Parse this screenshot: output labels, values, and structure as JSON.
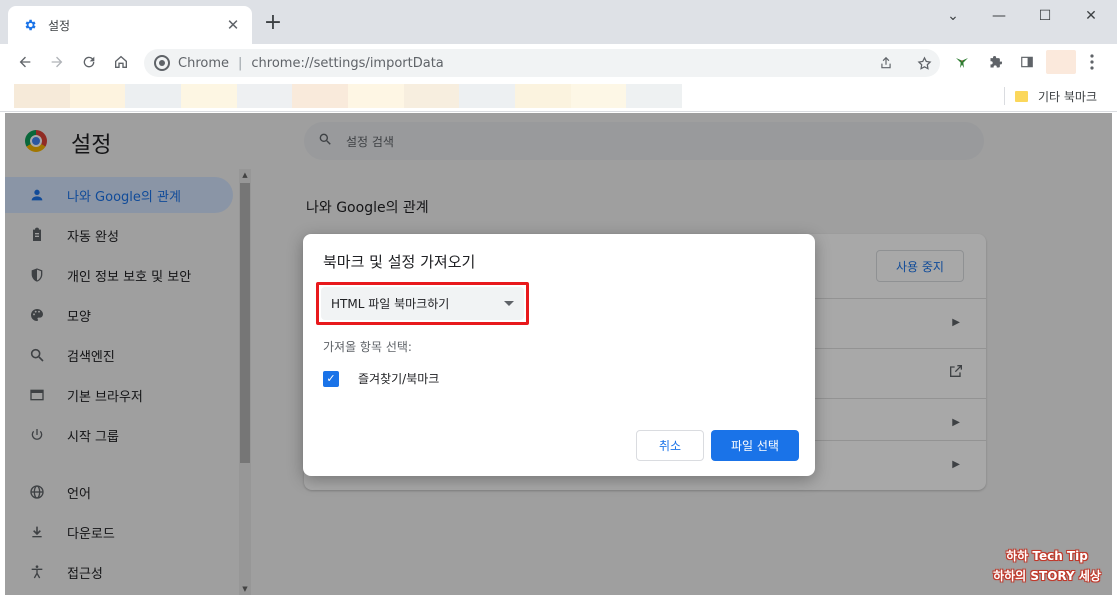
{
  "tab": {
    "title": "설정",
    "close": "✕",
    "new_tab": "+"
  },
  "window": {
    "minimize": "—",
    "maximize": "☐",
    "close": "✕",
    "tabsearch": "⌄"
  },
  "omnibox": {
    "site": "Chrome",
    "separator": "|",
    "url": "chrome://settings/importData"
  },
  "bookmarks": {
    "other_label": "기타 북마크",
    "blur_colors": [
      "#f6ead9",
      "#fdf3df",
      "#eceff1",
      "#fdf6e3",
      "#eef0f2",
      "#f9eadb",
      "#fef6e4",
      "#f7eedf",
      "#edf0f2",
      "#fbf3df",
      "#fdf7e6",
      "#eef1f2"
    ]
  },
  "settings": {
    "title": "설정",
    "search_placeholder": "설정 검색",
    "section_title": "나와 Google의 관계",
    "stop_sync": "사용 중지",
    "sidebar": [
      {
        "label": "나와 Google의 관계",
        "icon": "person-icon",
        "active": true
      },
      {
        "label": "자동 완성",
        "icon": "clipboard-icon"
      },
      {
        "label": "개인 정보 보호 및 보안",
        "icon": "shield-icon"
      },
      {
        "label": "모양",
        "icon": "palette-icon"
      },
      {
        "label": "검색엔진",
        "icon": "search-icon"
      },
      {
        "label": "기본 브라우저",
        "icon": "browser-icon"
      },
      {
        "label": "시작 그룹",
        "icon": "power-icon"
      },
      {
        "label": "언어",
        "icon": "globe-icon"
      },
      {
        "label": "다운로드",
        "icon": "download-icon"
      },
      {
        "label": "접근성",
        "icon": "accessibility-icon"
      }
    ]
  },
  "dialog": {
    "title": "북마크 및 설정 가져오기",
    "select_value": "HTML 파일 북마크하기",
    "items_label": "가져올 항목 선택:",
    "checkbox_label": "즐겨찾기/북마크",
    "checkbox_checked": true,
    "cancel": "취소",
    "choose_file": "파일 선택"
  },
  "watermark": {
    "line1": "하하 Tech Tip",
    "line2": "하하의 STORY 세상"
  },
  "colors": {
    "accent": "#1a73e8",
    "highlight": "#e8191c"
  }
}
